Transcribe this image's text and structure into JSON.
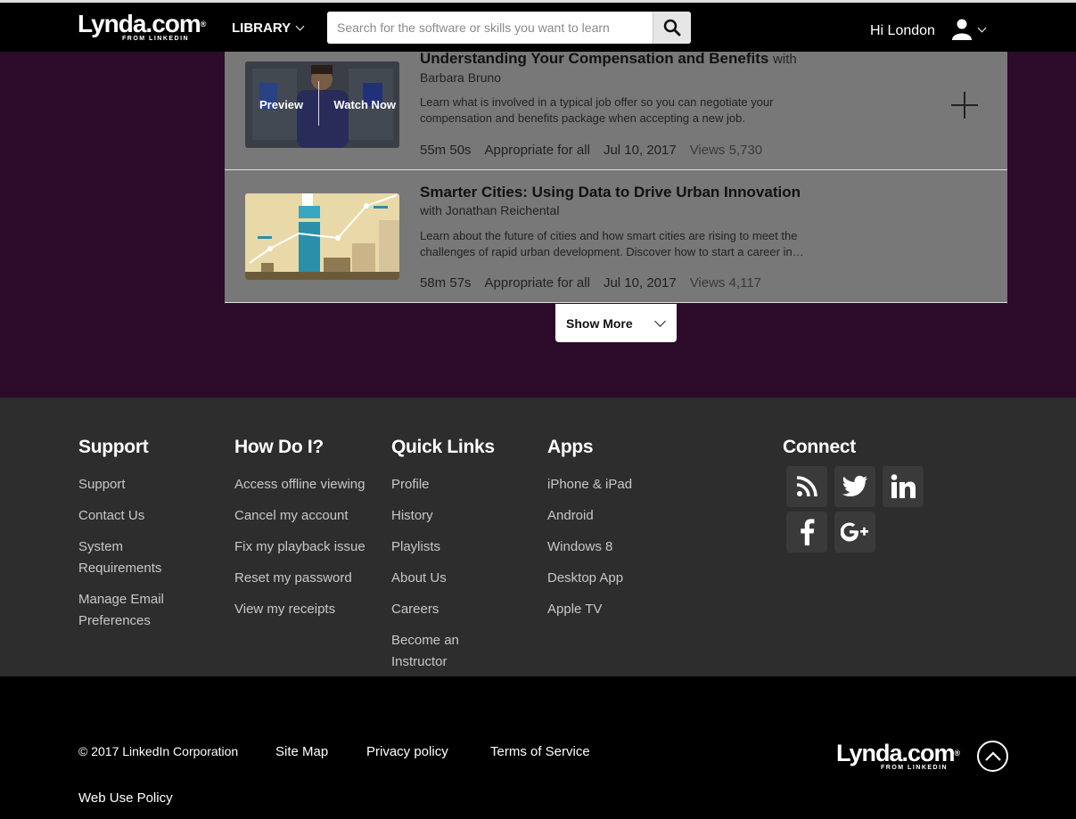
{
  "header": {
    "logo_word": "Lynda.com",
    "logo_mark": "®",
    "logo_sub": "FROM LINKEDIN",
    "library_label": "LIBRARY",
    "search_placeholder": "Search for the software or skills you want to learn",
    "search_icon": "search-icon",
    "greeting": "Hi London",
    "user_icon": "user-icon"
  },
  "courses": [
    {
      "title": "Understanding Your Compensation and Benefits",
      "with_label": "with",
      "author": "Barbara Bruno",
      "description": "Learn what is involved in a typical job offer so you can negotiate your compensation and benefits package when accepting a new job.",
      "duration": "55m 50s",
      "level": "Appropriate for all",
      "date": "Jul 10, 2017",
      "views": "Views 5,730",
      "preview_label": "Preview",
      "watch_label": "Watch Now"
    },
    {
      "title": "Smarter Cities: Using Data to Drive Urban Innovation",
      "author": "with Jonathan Reichental",
      "description": "Learn about the future of cities and how smart cities are rising to meet the challenges of rapid urban development. Discover how to start a career in…",
      "duration": "58m 57s",
      "level": "Appropriate for all",
      "date": "Jul 10, 2017",
      "views": "Views 4,117"
    }
  ],
  "show_more_label": "Show More",
  "footer": {
    "support": {
      "heading": "Support",
      "links": [
        "Support",
        "Contact Us",
        "System Requirements",
        "Manage Email Preferences"
      ]
    },
    "how_do_i": {
      "heading": "How Do I?",
      "links": [
        "Access offline viewing",
        "Cancel my account",
        "Fix my playback issue",
        "Reset my password",
        "View my receipts"
      ]
    },
    "quick_links": {
      "heading": "Quick Links",
      "links": [
        "Profile",
        "History",
        "Playlists",
        "About Us",
        "Careers",
        "Become an Instructor"
      ]
    },
    "apps": {
      "heading": "Apps",
      "links": [
        "iPhone & iPad",
        "Android",
        "Windows 8",
        "Desktop App",
        "Apple TV"
      ]
    },
    "connect": {
      "heading": "Connect",
      "icons": [
        "rss-icon",
        "twitter-icon",
        "linkedin-icon",
        "facebook-icon",
        "google-plus-icon"
      ]
    }
  },
  "bottom": {
    "copyright": "© 2017 LinkedIn Corporation",
    "site_map": "Site Map",
    "privacy": "Privacy policy",
    "terms": "Terms of Service",
    "web_use": "Web Use Policy"
  },
  "colors": {
    "purple_bg": "#2b0a2a",
    "card_bg": "#787878",
    "footer_bg": "#2d2d2d"
  }
}
